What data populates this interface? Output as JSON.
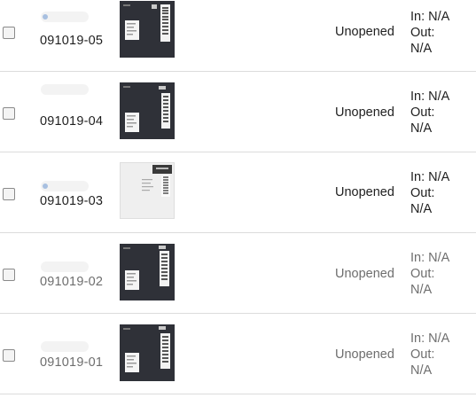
{
  "mail_items": [
    {
      "id": "091019-05",
      "status": "Unopened",
      "in_label": "In:",
      "in_value": "N/A",
      "out_label": "Out:",
      "out_value": "N/A",
      "envelope": "dark"
    },
    {
      "id": "091019-04",
      "status": "Unopened",
      "in_label": "In:",
      "in_value": "N/A",
      "out_label": "Out:",
      "out_value": "N/A",
      "envelope": "dark"
    },
    {
      "id": "091019-03",
      "status": "Unopened",
      "in_label": "In:",
      "in_value": "N/A",
      "out_label": "Out:",
      "out_value": "N/A",
      "envelope": "light"
    },
    {
      "id": "091019-02",
      "status": "Unopened",
      "in_label": "In:",
      "in_value": "N/A",
      "out_label": "Out:",
      "out_value": "N/A",
      "envelope": "dark"
    },
    {
      "id": "091019-01",
      "status": "Unopened",
      "in_label": "In:",
      "in_value": "N/A",
      "out_label": "Out:",
      "out_value": "N/A",
      "envelope": "dark"
    }
  ]
}
